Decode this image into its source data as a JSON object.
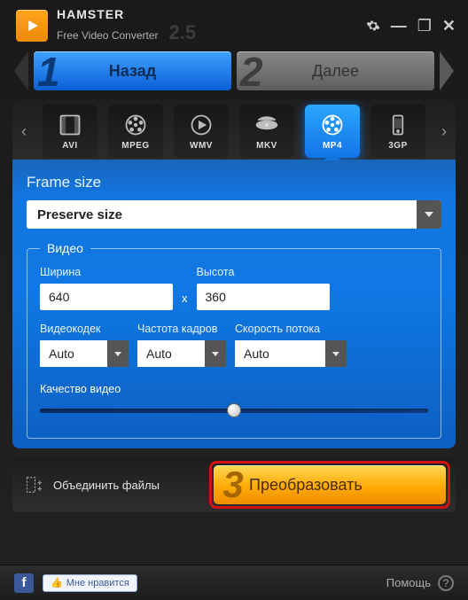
{
  "app": {
    "name": "HAMSTER",
    "subtitle": "Free Video Converter",
    "version": "2.5"
  },
  "wizard": {
    "back_num": "1",
    "back_label": "Назад",
    "next_num": "2",
    "next_label": "Далее"
  },
  "formats": {
    "items": [
      {
        "id": "avi",
        "label": "AVI"
      },
      {
        "id": "mpeg",
        "label": "MPEG"
      },
      {
        "id": "wmv",
        "label": "WMV"
      },
      {
        "id": "mkv",
        "label": "MKV"
      },
      {
        "id": "mp4",
        "label": "MP4"
      },
      {
        "id": "3gp",
        "label": "3GP"
      }
    ],
    "selected": "mp4"
  },
  "panel": {
    "title": "Frame size",
    "preserve_value": "Preserve size",
    "video": {
      "legend": "Видео",
      "width_label": "Ширина",
      "width_value": "640",
      "times": "x",
      "height_label": "Высота",
      "height_value": "360",
      "codec_label": "Видеокодек",
      "codec_value": "Auto",
      "fps_label": "Частота кадров",
      "fps_value": "Auto",
      "bitrate_label": "Скорость потока",
      "bitrate_value": "Auto",
      "quality_label": "Качество видео"
    }
  },
  "actions": {
    "merge_label": "Объединить файлы",
    "convert_num": "3",
    "convert_label": "Преобразовать"
  },
  "footer": {
    "like_label": "Мне нравится",
    "help_label": "Помощь"
  }
}
